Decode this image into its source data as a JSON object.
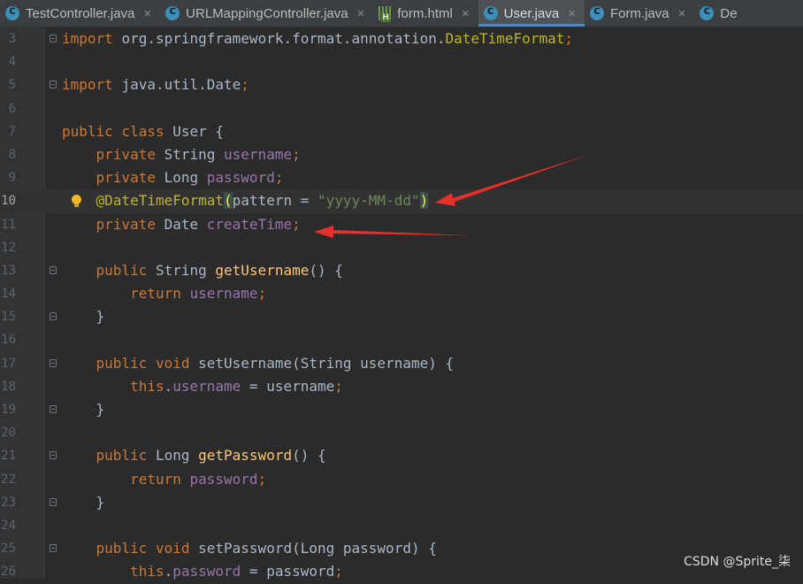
{
  "tabs": [
    {
      "label": "TestController.java",
      "icon": "java-class-icon",
      "active": false
    },
    {
      "label": "URLMappingController.java",
      "icon": "java-class-icon",
      "active": false
    },
    {
      "label": "form.html",
      "icon": "html-file-icon",
      "active": false
    },
    {
      "label": "User.java",
      "icon": "java-class-icon",
      "active": true
    },
    {
      "label": "Form.java",
      "icon": "java-class-icon",
      "active": false
    },
    {
      "label": "De",
      "icon": "java-class-icon",
      "active": false
    }
  ],
  "close_glyph": "×",
  "current_line": "10",
  "lines": [
    {
      "num": "3",
      "fold": true,
      "tokens": [
        {
          "t": "import ",
          "c": "kw"
        },
        {
          "t": "org.springframework.format.annotation.",
          "c": "txt"
        },
        {
          "t": "DateTimeFormat",
          "c": "ann"
        },
        {
          "t": ";",
          "c": "kw"
        }
      ]
    },
    {
      "num": "4",
      "tokens": []
    },
    {
      "num": "5",
      "fold": true,
      "tokens": [
        {
          "t": "import ",
          "c": "kw"
        },
        {
          "t": "java.util.Date",
          "c": "txt"
        },
        {
          "t": ";",
          "c": "kw"
        }
      ]
    },
    {
      "num": "6",
      "tokens": []
    },
    {
      "num": "7",
      "tokens": [
        {
          "t": "public class ",
          "c": "kw"
        },
        {
          "t": "User {",
          "c": "txt"
        }
      ]
    },
    {
      "num": "8",
      "tokens": [
        {
          "t": "    private ",
          "c": "kw"
        },
        {
          "t": "String ",
          "c": "txt"
        },
        {
          "t": "username",
          "c": "fld"
        },
        {
          "t": ";",
          "c": "kw"
        }
      ]
    },
    {
      "num": "9",
      "tokens": [
        {
          "t": "    private ",
          "c": "kw"
        },
        {
          "t": "Long ",
          "c": "txt"
        },
        {
          "t": "password",
          "c": "fld"
        },
        {
          "t": ";",
          "c": "kw"
        }
      ]
    },
    {
      "num": "10",
      "bulb": true,
      "tokens": [
        {
          "t": "    ",
          "c": "txt"
        },
        {
          "t": "@DateTimeFormat",
          "c": "ann"
        },
        {
          "t": "(",
          "c": "parhl"
        },
        {
          "t": "pattern = ",
          "c": "txt"
        },
        {
          "t": "\"yyyy-MM-dd\"",
          "c": "str"
        },
        {
          "t": ")",
          "c": "parhl"
        }
      ]
    },
    {
      "num": "11",
      "tokens": [
        {
          "t": "    private ",
          "c": "kw"
        },
        {
          "t": "Date ",
          "c": "txt"
        },
        {
          "t": "createTime",
          "c": "fld"
        },
        {
          "t": ";",
          "c": "kw"
        }
      ]
    },
    {
      "num": "12",
      "tokens": []
    },
    {
      "num": "13",
      "fold": true,
      "tokens": [
        {
          "t": "    public ",
          "c": "kw"
        },
        {
          "t": "String ",
          "c": "txt"
        },
        {
          "t": "getUsername",
          "c": "mth"
        },
        {
          "t": "() {",
          "c": "txt"
        }
      ]
    },
    {
      "num": "14",
      "tokens": [
        {
          "t": "        return ",
          "c": "kw"
        },
        {
          "t": "username",
          "c": "fld"
        },
        {
          "t": ";",
          "c": "kw"
        }
      ]
    },
    {
      "num": "15",
      "fold": true,
      "tokens": [
        {
          "t": "    }",
          "c": "txt"
        }
      ]
    },
    {
      "num": "16",
      "tokens": []
    },
    {
      "num": "17",
      "fold": true,
      "tokens": [
        {
          "t": "    public void ",
          "c": "kw"
        },
        {
          "t": "setUsername",
          "c": "txt"
        },
        {
          "t": "(String username) {",
          "c": "txt"
        }
      ]
    },
    {
      "num": "18",
      "tokens": [
        {
          "t": "        this",
          "c": "kw"
        },
        {
          "t": ".",
          "c": "txt"
        },
        {
          "t": "username",
          "c": "fld"
        },
        {
          "t": " = username",
          "c": "txt"
        },
        {
          "t": ";",
          "c": "kw"
        }
      ]
    },
    {
      "num": "19",
      "fold": true,
      "tokens": [
        {
          "t": "    }",
          "c": "txt"
        }
      ]
    },
    {
      "num": "20",
      "tokens": []
    },
    {
      "num": "21",
      "fold": true,
      "tokens": [
        {
          "t": "    public ",
          "c": "kw"
        },
        {
          "t": "Long ",
          "c": "txt"
        },
        {
          "t": "getPassword",
          "c": "mth"
        },
        {
          "t": "() {",
          "c": "txt"
        }
      ]
    },
    {
      "num": "22",
      "tokens": [
        {
          "t": "        return ",
          "c": "kw"
        },
        {
          "t": "password",
          "c": "fld"
        },
        {
          "t": ";",
          "c": "kw"
        }
      ]
    },
    {
      "num": "23",
      "fold": true,
      "tokens": [
        {
          "t": "    }",
          "c": "txt"
        }
      ]
    },
    {
      "num": "24",
      "tokens": []
    },
    {
      "num": "25",
      "fold": true,
      "tokens": [
        {
          "t": "    public void ",
          "c": "kw"
        },
        {
          "t": "setPassword",
          "c": "txt"
        },
        {
          "t": "(Long password) {",
          "c": "txt"
        }
      ]
    },
    {
      "num": "26",
      "tokens": [
        {
          "t": "        this",
          "c": "kw"
        },
        {
          "t": ".",
          "c": "txt"
        },
        {
          "t": "password",
          "c": "fld"
        },
        {
          "t": " = password",
          "c": "txt"
        },
        {
          "t": ";",
          "c": "kw"
        }
      ]
    }
  ],
  "annotation_arrows": {
    "color": "#e8302a",
    "targets": [
      "line-10",
      "line-11"
    ]
  },
  "watermark": "CSDN @Sprite_柒"
}
